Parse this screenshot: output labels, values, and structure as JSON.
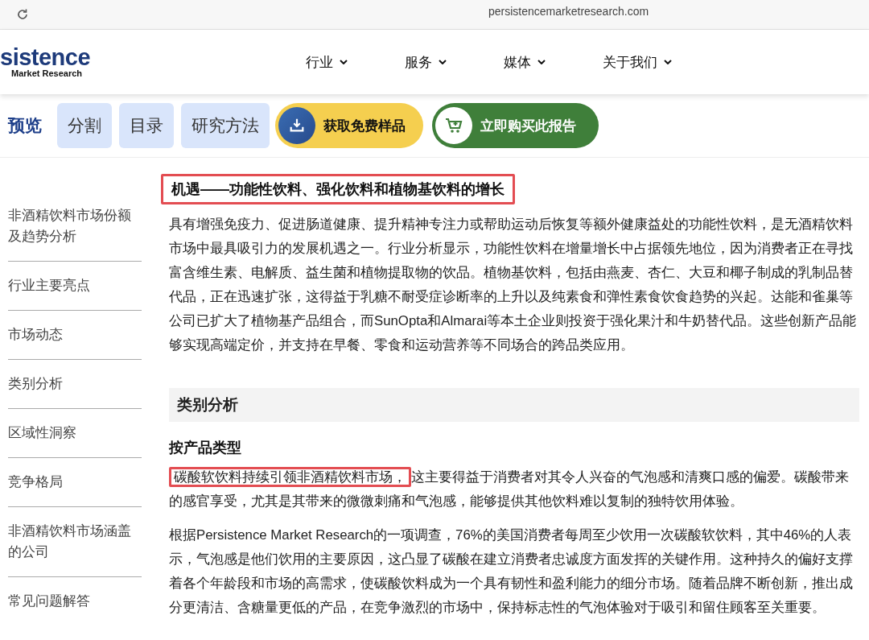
{
  "browser": {
    "url": "persistencemarketresearch.com"
  },
  "logo": {
    "wordmark": "sistence",
    "tagline": "Market Research"
  },
  "nav": [
    {
      "label": "行业"
    },
    {
      "label": "服务"
    },
    {
      "label": "媒体"
    },
    {
      "label": "关于我们"
    }
  ],
  "tabs": [
    {
      "label": "预览",
      "selected": true
    },
    {
      "label": "分割",
      "selected": false
    },
    {
      "label": "目录",
      "selected": false
    },
    {
      "label": "研究方法",
      "selected": false
    }
  ],
  "actions": [
    {
      "kind": "sample",
      "label": "获取免费样品"
    },
    {
      "kind": "buy",
      "label": "立即购买此报告"
    }
  ],
  "sidebar": {
    "items": [
      {
        "label": "非酒精饮料市场份额及趋势分析"
      },
      {
        "label": "行业主要亮点"
      },
      {
        "label": "市场动态"
      },
      {
        "label": "类别分析"
      },
      {
        "label": "区域性洞察"
      },
      {
        "label": "竞争格局"
      },
      {
        "label": "非酒精饮料市场涵盖的公司"
      },
      {
        "label": "常见问题解答"
      }
    ]
  },
  "content": [
    {
      "kind": "heading",
      "highlighted": true,
      "text": "机遇——功能性饮料、强化饮料和植物基饮料的增长"
    },
    {
      "kind": "paragraph",
      "segments": [
        {
          "text": "具有增强免疫力、促进肠道健康、提升精神专注力或帮助运动后恢复等额外健康益处的功能性饮料，是无酒精饮料市场中最具吸引力的发展机遇之一。行业分析显示，功能性饮料在增量增长中占据领先地位，因为消费者正在寻找富含维生素、电解质、益生菌和植物提取物的饮品。植物基饮料，包括由燕麦、杏仁、大豆和椰子制成的乳制品替代品，正在迅速扩张，这得益于乳糖不耐受症诊断率的上升以及纯素食和弹性素食饮食趋势的兴起。达能和雀巢等公司已扩大了植物基产品组合，而SunOpta和Almarai等本土企业则投资于强化果汁和牛奶替代品。这些创新产品能够实现高端定价，并支持在早餐、零食和运动营养等不同场合的跨品类应用。",
          "highlighted": false
        }
      ]
    },
    {
      "kind": "section",
      "text": "类别分析"
    },
    {
      "kind": "subheading",
      "text": "按产品类型"
    },
    {
      "kind": "paragraph",
      "segments": [
        {
          "text": "碳酸软饮料持续引领非酒精饮料市场，",
          "highlighted": true
        },
        {
          "text": "这主要得益于消费者对其令人兴奋的气泡感和清爽口感的偏爱。碳酸带来的感官享受，尤其是其带来的微微刺痛和气泡感，能够提供其他饮料难以复制的独特饮用体验。",
          "highlighted": false
        }
      ]
    },
    {
      "kind": "paragraph",
      "segments": [
        {
          "text": "根据Persistence Market Research的一项调查，76%的美国消费者每周至少饮用一次碳酸软饮料，其中46%的人表示，气泡感是他们饮用的主要原因，这凸显了碳酸在建立消费者忠诚度方面发挥的关键作用。这种持久的偏好支撑着各个年龄段和市场的高需求，使碳酸饮料成为一个具有韧性和盈利能力的细分市场。随着品牌不断创新，推出成分更清洁、含糖量更低的产品，在竞争激烈的市场中，保持标志性的气泡体验对于吸引和留住顾客至关重要。",
          "highlighted": false
        }
      ]
    }
  ]
}
